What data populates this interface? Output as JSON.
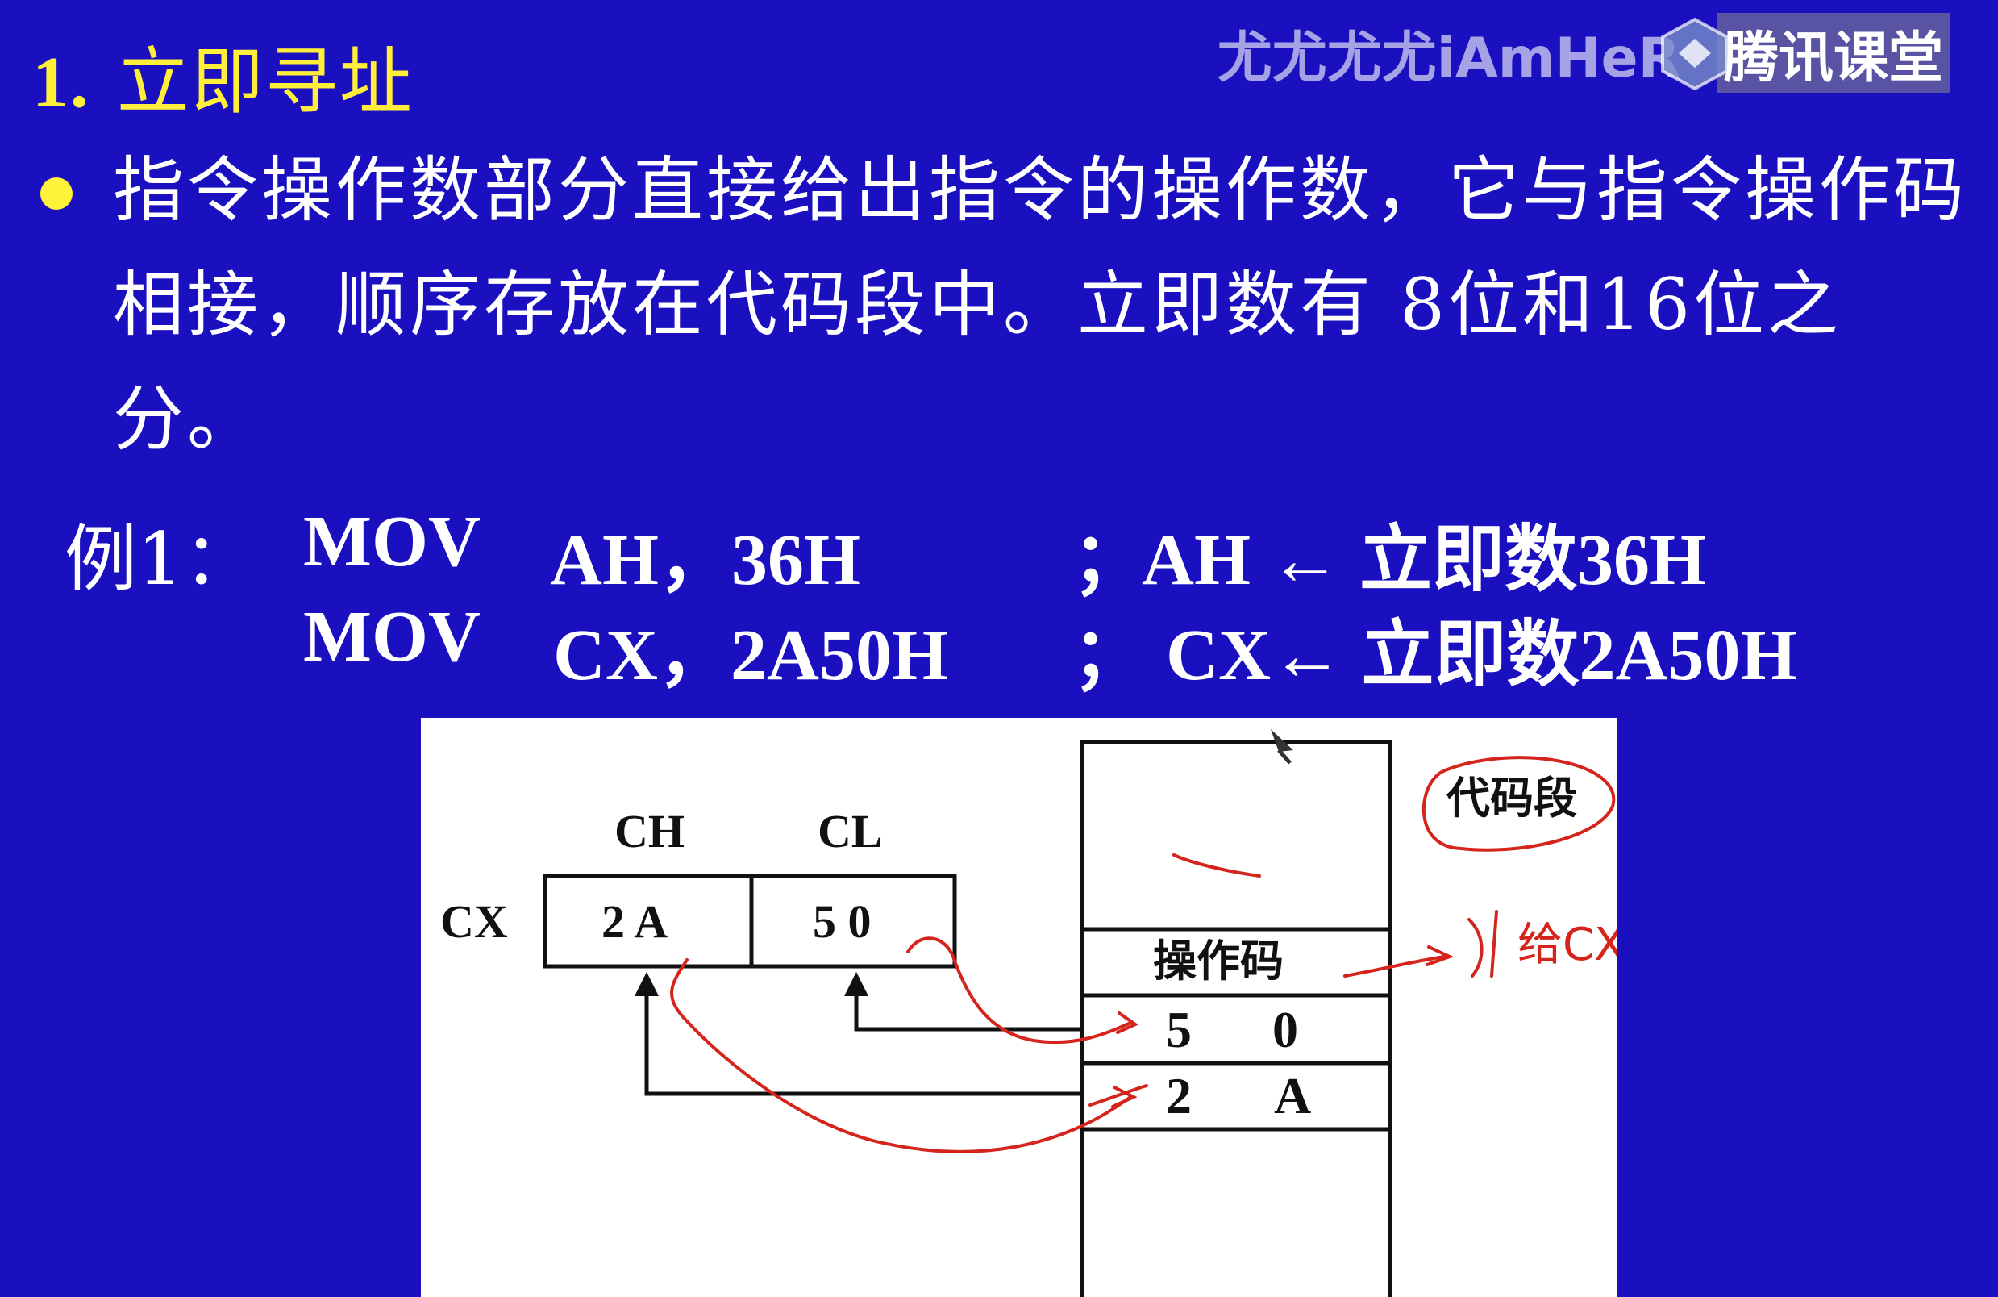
{
  "title": {
    "number": "1.",
    "text": "立即寻址"
  },
  "watermark": {
    "user": "尤尤尤尤iAmHeR",
    "brand": "腾讯课堂",
    "logo_icon": "tencent-classroom-logo-icon"
  },
  "bullet": {
    "icon": "bullet-dot-icon",
    "text": "指令操作数部分直接给出指令的操作数，它与指令操作码相接，顺序存放在代码段中。立即数有 8位和16位之分。"
  },
  "example": {
    "label": "例1：",
    "line1": {
      "instr": "MOV",
      "operands": "AH，36H",
      "sep": "；",
      "comment": "AH ← 立即数36H"
    },
    "line2": {
      "instr": "MOV",
      "operands": "CX，2A50H",
      "sep": "；",
      "comment": "CX← 立即数2A50H"
    }
  },
  "figure": {
    "reg_name": "CX",
    "ch_label": "CH",
    "cl_label": "CL",
    "ch_value": "2 A",
    "cl_value": "5 0",
    "opcode_label": "操作码",
    "mem_byte1": {
      "a": "5",
      "b": "0"
    },
    "mem_byte2": {
      "a": "2",
      "b": "A"
    },
    "annotation_circle": "代码段",
    "annotation_note": "给CX赋值",
    "annotation_color": "#d4241c"
  }
}
